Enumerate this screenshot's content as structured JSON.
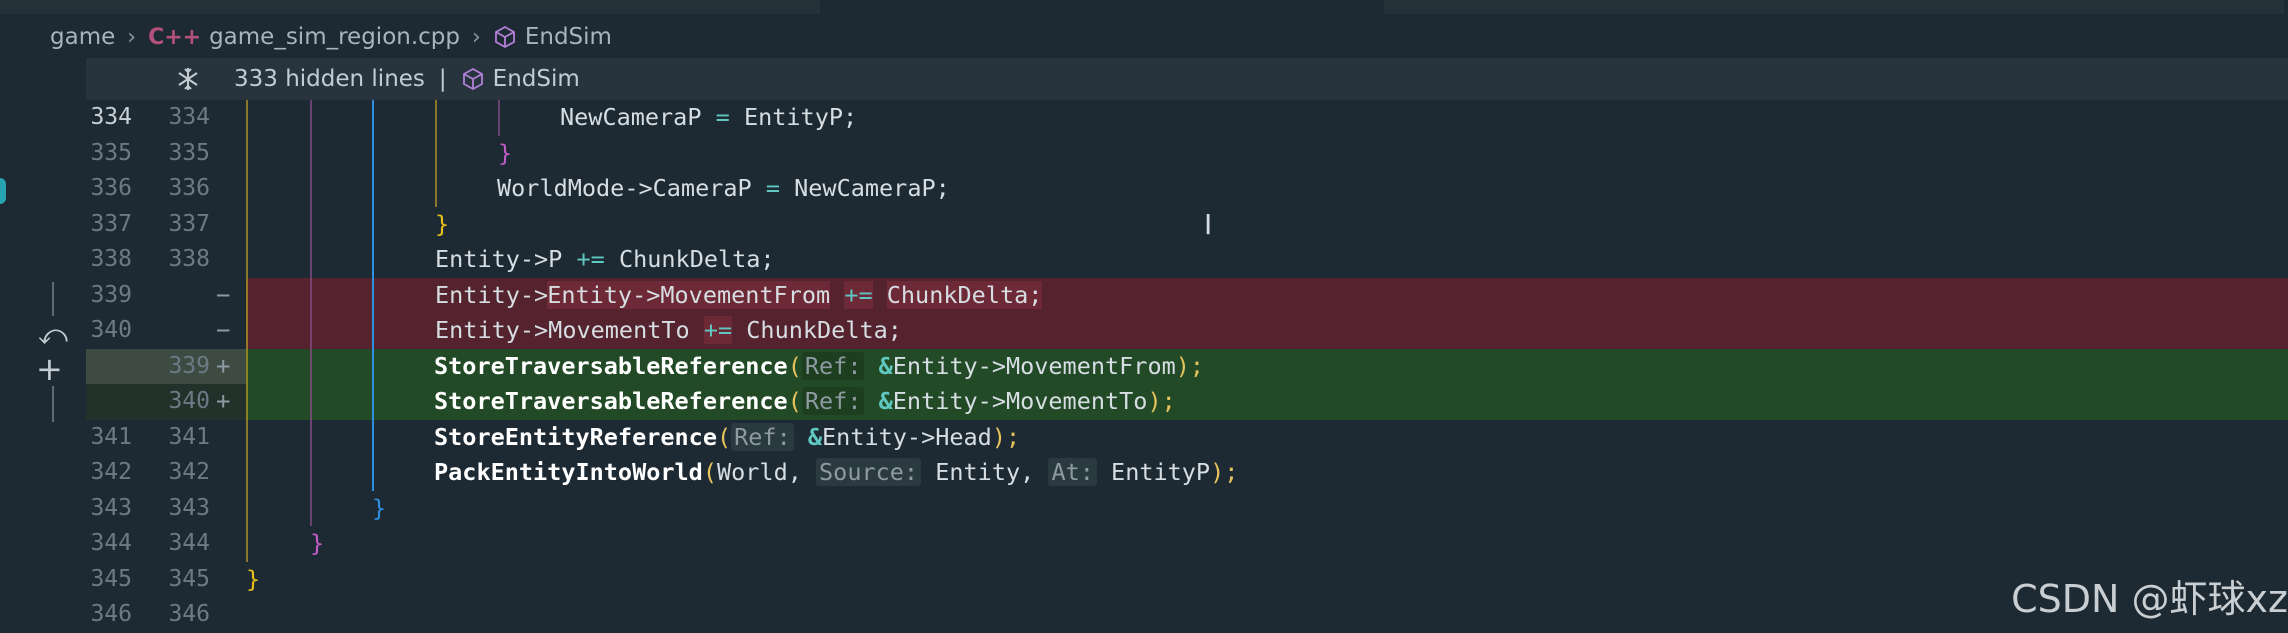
{
  "breadcrumb": {
    "folder": "game",
    "file": "game_sim_region.cpp",
    "file_icon": "C++",
    "symbol": "EndSim"
  },
  "sticky": {
    "hidden_lines": "333 hidden lines",
    "separator": "|",
    "symbol": "EndSim"
  },
  "lines": [
    {
      "old": "334",
      "new": "334",
      "type": "ctx",
      "current": true
    },
    {
      "old": "335",
      "new": "335",
      "type": "ctx"
    },
    {
      "old": "336",
      "new": "336",
      "type": "ctx"
    },
    {
      "old": "337",
      "new": "337",
      "type": "ctx"
    },
    {
      "old": "338",
      "new": "338",
      "type": "ctx"
    },
    {
      "old": "339",
      "new": "",
      "marker": "−",
      "type": "removed"
    },
    {
      "old": "340",
      "new": "",
      "marker": "−",
      "type": "removed"
    },
    {
      "old": "",
      "new": "339",
      "marker": "+",
      "type": "added"
    },
    {
      "old": "",
      "new": "340",
      "marker": "+",
      "type": "added"
    },
    {
      "old": "341",
      "new": "341",
      "type": "ctx"
    },
    {
      "old": "342",
      "new": "342",
      "type": "ctx"
    },
    {
      "old": "343",
      "new": "343",
      "type": "ctx"
    },
    {
      "old": "344",
      "new": "344",
      "type": "ctx"
    },
    {
      "old": "345",
      "new": "345",
      "type": "ctx"
    },
    {
      "old": "346",
      "new": "346",
      "type": "ctx"
    }
  ],
  "code": {
    "l334": {
      "a": "NewCameraP",
      "op": "=",
      "b": "EntityP;"
    },
    "l335": "}",
    "l336": {
      "a": "WorldMode->CameraP",
      "op": "=",
      "b": "NewCameraP;"
    },
    "l337": "}",
    "l338": {
      "a": "Entity->P",
      "op": "+=",
      "b": "ChunkDelta;"
    },
    "l339r": {
      "a": "Entity->MovementFrom",
      "op": "+=",
      "b": "ChunkDelta;"
    },
    "l340r": {
      "a": "Entity->MovementTo",
      "op": "+=",
      "b": "ChunkDelta;"
    },
    "l339a": {
      "fn": "StoreTraversableReference",
      "hint": "Ref:",
      "arg": "Entity->MovementFrom",
      "end": ");"
    },
    "l340a": {
      "fn": "StoreTraversableReference",
      "hint": "Ref:",
      "arg": "Entity->MovementTo",
      "end": ");"
    },
    "l341": {
      "fn": "StoreEntityReference",
      "hint": "Ref:",
      "arg": "Entity->Head",
      "end": ");"
    },
    "l342": {
      "fn": "PackEntityIntoWorld",
      "arg1": "World,",
      "hint2": "Source:",
      "arg2": "Entity,",
      "hint3": "At:",
      "arg3": "EntityP",
      "end": ");"
    },
    "l343": "}",
    "l344": "}",
    "l345": "}",
    "amp": "&",
    "lparen": "("
  },
  "watermark": "CSDN @虾球xz",
  "colors": {
    "background": "#1e2a33",
    "removed": "#55232d",
    "added": "#234a26",
    "operator": "#5fc8c1",
    "brace_pink": "#c15bc6",
    "brace_yellow": "#e4c019",
    "brace_blue": "#2e8fe0"
  }
}
